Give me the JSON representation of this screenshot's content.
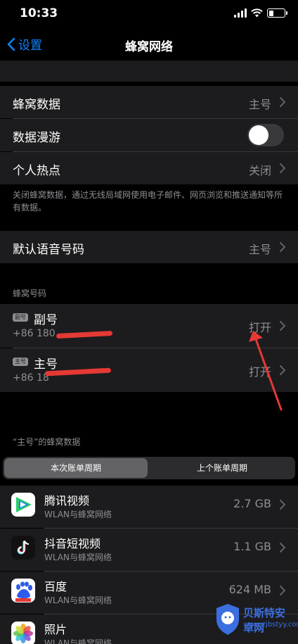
{
  "status_bar": {
    "time": "10:33"
  },
  "nav": {
    "back_label": "设置",
    "title": "蜂窝网络"
  },
  "settings": {
    "cellular_data": {
      "label": "蜂窝数据",
      "value": "主号"
    },
    "data_roaming": {
      "label": "数据漫游",
      "enabled": false
    },
    "hotspot": {
      "label": "个人热点",
      "value": "关闭"
    },
    "footnote": "关闭蜂窝数据，通过无线局域网使用电子邮件、网页浏览和推送通知等所有数据。",
    "default_voice": {
      "label": "默认语音号码",
      "value": "主号"
    }
  },
  "sim_section": {
    "header": "蜂窝号码",
    "lines": [
      {
        "badge": "副号",
        "name": "副号",
        "number": "+86 180",
        "value": "打开"
      },
      {
        "badge": "主号",
        "name": "主号",
        "number": "+86 18",
        "value": "打开"
      }
    ]
  },
  "usage": {
    "header": "“主号”的蜂窝数据",
    "segments": [
      "本次账单周期",
      "上个账单周期"
    ],
    "apps": [
      {
        "name": "腾讯视频",
        "sub": "WLAN与蜂窝网络",
        "size": "2.7 GB",
        "icon": "tencent-video-icon"
      },
      {
        "name": "抖音短视频",
        "sub": "WLAN与蜂窝网络",
        "size": "1.1 GB",
        "icon": "douyin-icon"
      },
      {
        "name": "百度",
        "sub": "WLAN与蜂窝网络",
        "size": "624 MB",
        "icon": "baidu-icon"
      },
      {
        "name": "照片",
        "sub": "WLAN与蜂窝网络",
        "size": "",
        "icon": "photos-icon"
      }
    ]
  },
  "watermark": {
    "title": "贝斯特安卓网",
    "sub": "www.zjbstyy.com"
  },
  "colors": {
    "accent": "#0a84ff",
    "annotation": "#e53935",
    "cell_bg": "#1c1c1e"
  }
}
